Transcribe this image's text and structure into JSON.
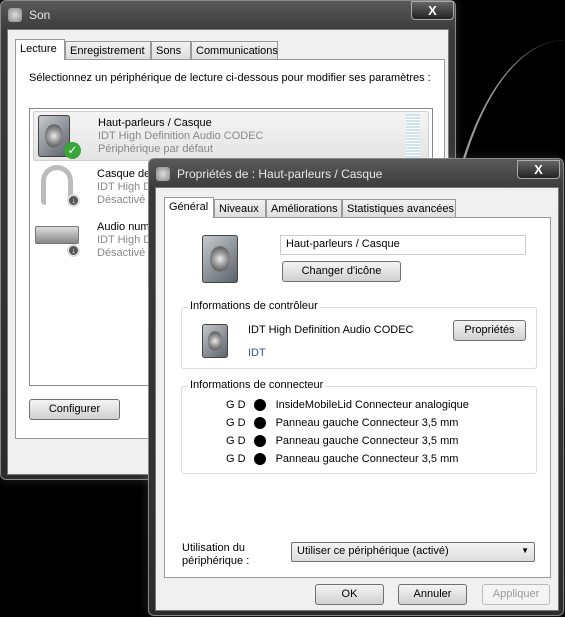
{
  "son": {
    "title": "Son",
    "close": "X",
    "tabs": [
      "Lecture",
      "Enregistrement",
      "Sons",
      "Communications"
    ],
    "instruction": "Sélectionnez un périphérique de lecture ci-dessous pour modifier ses paramètres :",
    "devices": [
      {
        "name": "Haut-parleurs / Casque",
        "driver": "IDT High Definition Audio CODEC",
        "status": "Périphérique par défaut",
        "icon": "speaker-default-icon"
      },
      {
        "name": "Casque de",
        "driver": "IDT High D",
        "status": "Désactivé",
        "icon": "headphones-icon"
      },
      {
        "name": "Audio num",
        "driver": "IDT High D",
        "status": "Désactivé",
        "icon": "digital-audio-icon"
      }
    ],
    "configure": "Configurer"
  },
  "props": {
    "title": "Propriétés de : Haut-parleurs / Casque",
    "close": "X",
    "tabs": [
      "Général",
      "Niveaux",
      "Améliorations",
      "Statistiques avancées"
    ],
    "device_name": "Haut-parleurs / Casque",
    "change_icon": "Changer d'icône",
    "controller": {
      "legend": "Informations de contrôleur",
      "name": "IDT High Definition Audio CODEC",
      "vendor": "IDT",
      "properties": "Propriétés"
    },
    "connector": {
      "legend": "Informations de connecteur",
      "rows": [
        {
          "channels": "G D",
          "label": "InsideMobileLid Connecteur analogique"
        },
        {
          "channels": "G D",
          "label": "Panneau gauche Connecteur 3,5 mm"
        },
        {
          "channels": "G D",
          "label": "Panneau gauche Connecteur 3,5 mm"
        },
        {
          "channels": "G D",
          "label": "Panneau gauche Connecteur 3,5 mm"
        }
      ]
    },
    "usage_label_1": "Utilisation du",
    "usage_label_2": "périphérique :",
    "usage_value": "Utiliser ce périphérique (activé)",
    "ok": "OK",
    "cancel": "Annuler",
    "apply": "Appliquer"
  }
}
